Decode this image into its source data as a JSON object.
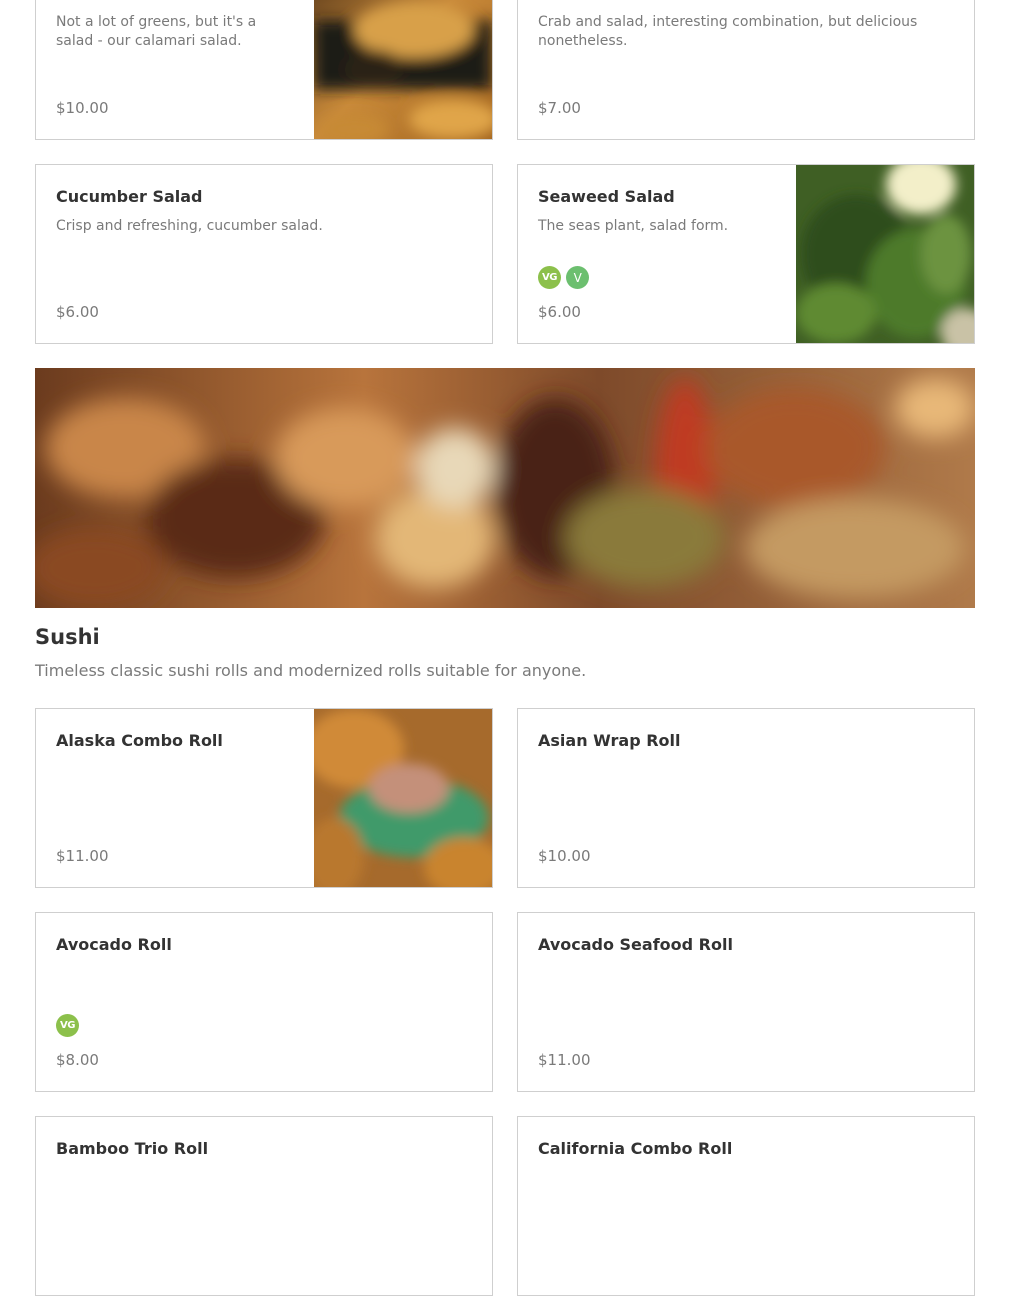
{
  "salads": {
    "items": [
      {
        "description": "Not a lot of greens, but it's a salad - our calamari salad.",
        "price": "$10.00"
      },
      {
        "description": "Crab and salad, interesting combination, but delicious nonetheless.",
        "price": "$7.00"
      },
      {
        "name": "Cucumber Salad",
        "description": "Crisp and refreshing, cucumber salad.",
        "price": "$6.00"
      },
      {
        "name": "Seaweed Salad",
        "description": "The seas plant, salad form.",
        "badges": [
          "VG",
          "V"
        ],
        "price": "$6.00"
      }
    ]
  },
  "sushi": {
    "title": "Sushi",
    "description": "Timeless classic sushi rolls and modernized rolls suitable for anyone.",
    "items": [
      {
        "name": "Alaska Combo Roll",
        "price": "$11.00"
      },
      {
        "name": "Asian Wrap Roll",
        "price": "$10.00"
      },
      {
        "name": "Avocado Roll",
        "badges": [
          "VG"
        ],
        "price": "$8.00"
      },
      {
        "name": "Avocado Seafood Roll",
        "price": "$11.00"
      },
      {
        "name": "Bamboo Trio Roll"
      },
      {
        "name": "California Combo Roll"
      }
    ]
  },
  "colors": {
    "vegan_badge": "#8cc04b",
    "vegetarian_badge": "#6cbf6f",
    "card_border": "#cfcfcf"
  }
}
